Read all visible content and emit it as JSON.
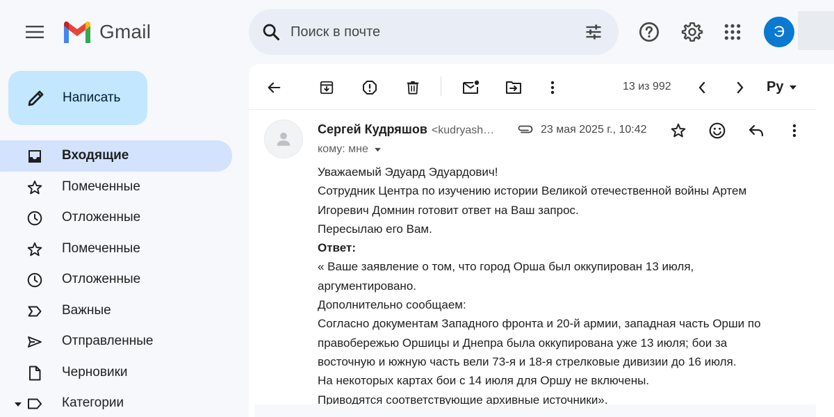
{
  "header": {
    "app_name": "Gmail",
    "search_placeholder": "Поиск в почте",
    "avatar_letter": "Э"
  },
  "compose": {
    "label": "Написать"
  },
  "sidebar": {
    "items": [
      {
        "label": "Входящие",
        "icon": "inbox-icon",
        "active": true
      },
      {
        "label": "Помеченные",
        "icon": "star-icon"
      },
      {
        "label": "Отложенные",
        "icon": "clock-icon"
      },
      {
        "label": "Помеченные",
        "icon": "star-icon"
      },
      {
        "label": "Отложенные",
        "icon": "clock-icon"
      },
      {
        "label": "Важные",
        "icon": "label-important-icon"
      },
      {
        "label": "Отправленные",
        "icon": "send-icon"
      },
      {
        "label": "Черновики",
        "icon": "draft-icon"
      },
      {
        "label": "Категории",
        "icon": "label-icon",
        "expandable": true
      }
    ]
  },
  "toolbar": {
    "counter": "13 из 992",
    "language": "Ру"
  },
  "message": {
    "sender_name": "Сергей Кудряшов",
    "sender_email": "<kudryash…",
    "date": "23 мая 2025 г., 10:42",
    "to_label": "кому: мне",
    "body": [
      {
        "text": "Уважаемый Эдуард Эдуардович!",
        "bold": false
      },
      {
        "text": "Сотрудник Центра по изучению истории Великой отечественной войны Артем",
        "bold": false
      },
      {
        "text": "Игоревич Домнин готовит ответ на Ваш запрос.",
        "bold": false
      },
      {
        "text": "Пересылаю его Вам.",
        "bold": false
      },
      {
        "text": "Ответ:",
        "bold": true
      },
      {
        "text": "« Ваше заявление о том, что город Орша был оккупирован 13 июля,",
        "bold": false
      },
      {
        "text": "аргументировано.",
        "bold": false
      },
      {
        "text": "Дополнительно сообщаем:",
        "bold": false
      },
      {
        "text": "Согласно документам Западного фронта и 20-й армии, западная часть Орши по",
        "bold": false
      },
      {
        "text": "правобережью Оршицы и Днепра была оккупирована уже 13 июля; бои за",
        "bold": false
      },
      {
        "text": "восточную и южную часть вели 73-я и 18-я стрелковые дивизии до 16 июля.",
        "bold": false
      },
      {
        "text": "На некоторых картах бои с 14 июля для Оршу не включены.",
        "bold": false
      },
      {
        "text": "Приводятся соответствующие архивные источники».",
        "bold": false
      }
    ]
  }
}
